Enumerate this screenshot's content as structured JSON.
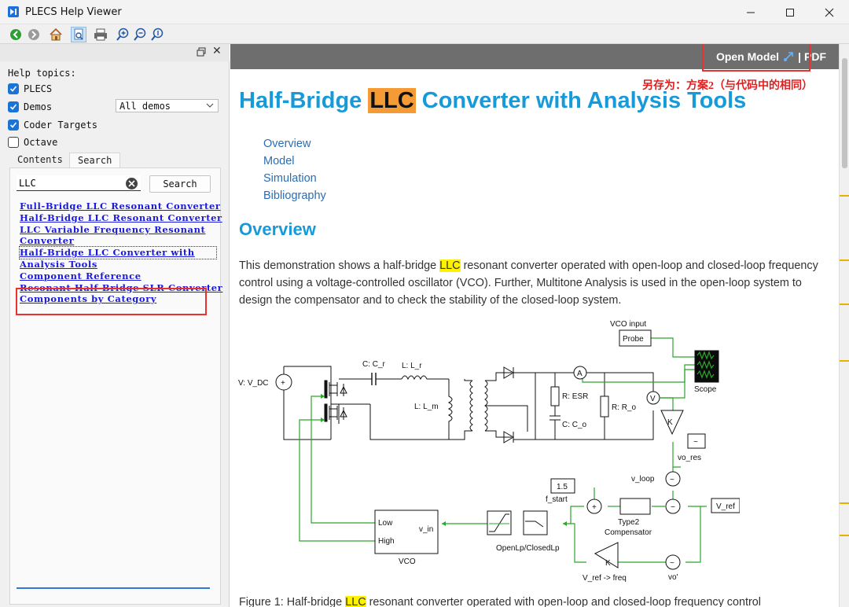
{
  "window": {
    "title": "PLECS Help Viewer",
    "controls": [
      "minimize",
      "maximize",
      "close"
    ]
  },
  "toolbar": {
    "buttons": [
      "back-icon",
      "forward-icon",
      "home-icon",
      "sync-toc-icon",
      "print-icon",
      "zoom-in-icon",
      "zoom-out-icon",
      "zoom-reset-icon"
    ]
  },
  "left_panel": {
    "help_topics_label": "Help topics:",
    "filters": [
      {
        "label": "PLECS",
        "checked": true
      },
      {
        "label": "Demos",
        "checked": true
      },
      {
        "label": "Coder Targets",
        "checked": true
      },
      {
        "label": "Octave",
        "checked": false
      }
    ],
    "demos_select": "All demos",
    "tabs": [
      "Contents",
      "Search"
    ],
    "active_tab": "Search",
    "search_value": "LLC",
    "search_button": "Search",
    "results": [
      "Full-Bridge LLC Resonant Converter",
      "Half-Bridge LLC Resonant Converter",
      "LLC Variable Frequency Resonant",
      "Converter",
      "Half-Bridge LLC Converter with",
      "Analysis Tools",
      "Component Reference",
      "Resonant Half-Bridge SLR Converter",
      "Components by Category"
    ]
  },
  "content": {
    "top_links": {
      "open_model": "Open Model",
      "separator": "|",
      "pdf": "PDF"
    },
    "annotation": "另存为：方案2（与代码中的相同）",
    "title_pre": "Half-Bridge ",
    "title_hl": "LLC",
    "title_post": " Converter with Analysis Tools",
    "toc": [
      "Overview",
      "Model",
      "Simulation",
      "Bibliography"
    ],
    "overview_heading": "Overview",
    "para_1": "This demonstration shows a half-bridge ",
    "para_hl": "LLC",
    "para_2": " resonant converter operated with open-loop and closed-loop frequency control using a voltage-controlled oscillator (VCO). Further, Multitone Analysis is used in the open-loop system to design the compensator and to check the stability of the closed-loop system.",
    "caption_1": "Figure 1:    Half-bridge ",
    "caption_hl": "LLC",
    "caption_2": " resonant converter operated with open-loop and closed-loop frequency control"
  },
  "figure": {
    "vdc": "V: V_DC",
    "cr": "C: C_r",
    "lr": "L: L_r",
    "lm": "L: L_m",
    "esr": "R: ESR",
    "co": "C: C_o",
    "ro": "R: R_o",
    "vco_input": "VCO input",
    "probe": "Probe",
    "scope": "Scope",
    "vo_res": "vo_res",
    "v_loop": "v_loop",
    "f_start_val": "1.5",
    "f_start": "f_start",
    "compensator": "Type2\nCompensator",
    "type2": "Type2",
    "comp": "Compensator",
    "v_ref": "V_ref",
    "vco": "VCO",
    "low": "Low",
    "high": "High",
    "v_in": "v_in",
    "openclosed": "OpenLp/ClosedLp",
    "k": "K",
    "vref_freq": "V_ref -> freq",
    "vo_prime": "vo'",
    "ammeter": "A",
    "voltmeter": "V",
    "sum_plus": "+",
    "sum_minus": "−",
    "tilde": "~"
  }
}
